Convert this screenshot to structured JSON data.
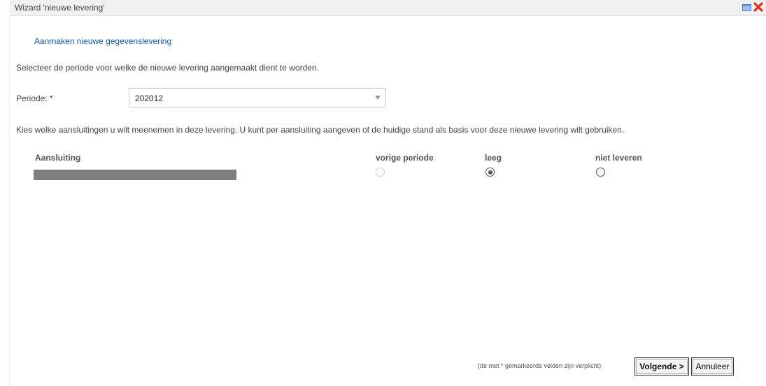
{
  "window": {
    "title": "Wizard 'nieuwe levering'",
    "icons": [
      "restore-icon",
      "close-icon"
    ],
    "close_color": "#e0301e"
  },
  "wizard": {
    "subheader": "Aanmaken nieuwe gegevenslevering",
    "instruction": "Selecteer de periode voor welke de nieuwe levering aangemaakt dient te worden.",
    "period": {
      "label": "Periode: *",
      "value": "202012"
    },
    "instruction2": "Kies welke aansluitingen u wilt meenemen in deze levering. U kunt per aansluiting aangeven of de huidige stand als basis voor deze nieuwe levering wilt gebruiken."
  },
  "table": {
    "headers": [
      "Aansluiting",
      "vorige periode",
      "leeg",
      "niet leveren"
    ],
    "rows": [
      {
        "options": [
          {
            "name": "vorige periode",
            "selected": false,
            "disabled": true
          },
          {
            "name": "leeg",
            "selected": true,
            "disabled": false
          },
          {
            "name": "niet leveren",
            "selected": false,
            "disabled": false
          }
        ]
      }
    ]
  },
  "footer": {
    "hint": "(de met * gemarkeerde velden zijn verplicht)",
    "next_label": "Volgende >",
    "cancel_label": "Annuleer"
  },
  "colors": {
    "link": "#1a5aa6",
    "titlebar": "#f0f0f0",
    "redacted": "#7f7f7f"
  }
}
